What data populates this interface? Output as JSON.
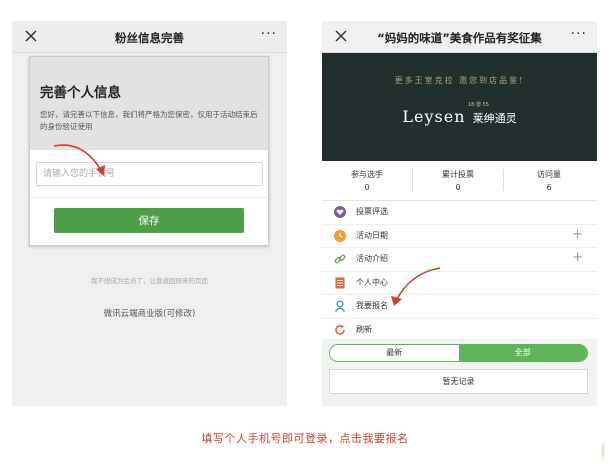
{
  "left_phone": {
    "nav": {
      "title": "粉丝信息完善",
      "more": "···"
    },
    "card": {
      "heading": "完善个人信息",
      "description": "您好，请完善以下信息，我们将严格为您保密，仅用于活动结束后的身份验证使用",
      "phone_placeholder": "请输入您的手机号",
      "save_label": "保存"
    },
    "hint": "我不想成为会员了，让我返回原来的页面",
    "brand": "微讯云端商业版(可修改)"
  },
  "right_phone": {
    "nav": {
      "title": "“妈妈的味道”美食作品有奖征集",
      "more": "···"
    },
    "banner": {
      "slogan": "更多王室克拉 邀您到店品鉴!",
      "since": "18·雷·55",
      "logo_en": "Leysen",
      "logo_zh": "莱绅通灵"
    },
    "stats": [
      {
        "label": "参与选手",
        "value": "0"
      },
      {
        "label": "累计投票",
        "value": "0"
      },
      {
        "label": "访问量",
        "value": "6"
      }
    ],
    "menu": [
      {
        "label": "投票评选",
        "icon": "heart-icon",
        "color": "#7b5aa6",
        "expand": ""
      },
      {
        "label": "活动日期",
        "icon": "clock-icon",
        "color": "#f0a030",
        "expand": "+"
      },
      {
        "label": "活动介绍",
        "icon": "link-icon",
        "color": "#5aa75a",
        "expand": "+"
      },
      {
        "label": "个人中心",
        "icon": "list-icon",
        "color": "#e0643c",
        "expand": ""
      },
      {
        "label": "我要报名",
        "icon": "user-icon",
        "color": "#4aa0c8",
        "expand": ""
      },
      {
        "label": "刷新",
        "icon": "refresh-icon",
        "color": "#e0643c",
        "expand": ""
      }
    ],
    "tabs": [
      "最新",
      "全部"
    ],
    "empty_label": "暂无记录"
  },
  "caption": "填写个人手机号即可登录，点击我要报名",
  "colors": {
    "save_green": "#4c9e47",
    "tab_green": "#5fb45a",
    "annotation_red": "#d2412d",
    "banner_dark": "#20302e"
  }
}
